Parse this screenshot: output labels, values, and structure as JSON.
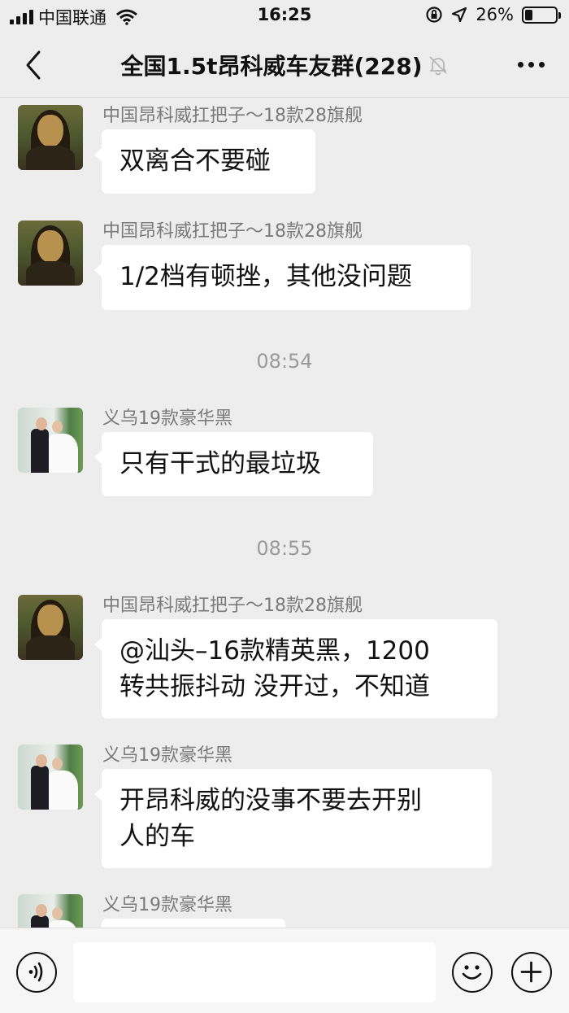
{
  "status_bar": {
    "carrier": "中国联通",
    "time": "16:25",
    "battery_percent": "26%",
    "battery_level": 0.26
  },
  "nav": {
    "title": "全国1.5t昂科威车友群(228)",
    "muted_icon": "bell-muted-icon",
    "back_icon": "chevron-left-icon",
    "more_icon": "more-dots-icon"
  },
  "messages": [
    {
      "sender": "中国昂科威扛把子～18款28旗舰",
      "avatar": "mona-lisa",
      "lines": [
        "双离合不要碰"
      ]
    },
    {
      "sender": "中国昂科威扛把子～18款28旗舰",
      "avatar": "mona-lisa",
      "lines": [
        "1/2档有顿挫，其他没问题"
      ]
    },
    {
      "time": "08:54"
    },
    {
      "sender": "义乌19款豪华黑",
      "avatar": "wedding-couple",
      "lines": [
        "只有干式的最垃圾"
      ]
    },
    {
      "time": "08:55"
    },
    {
      "sender": "中国昂科威扛把子～18款28旗舰",
      "avatar": "mona-lisa",
      "lines": [
        "@汕头–16款精英黑，1200",
        "转共振抖动 没开过，不知道"
      ]
    },
    {
      "sender": "义乌19款豪华黑",
      "avatar": "wedding-couple",
      "lines": [
        "开昂科威的没事不要去开别",
        "人的车"
      ]
    },
    {
      "sender": "义乌19款豪华黑",
      "avatar": "wedding-couple",
      "lines": [
        ""
      ]
    }
  ],
  "input_bar": {
    "voice_icon": "voice-icon",
    "emoji_icon": "emoji-icon",
    "plus_icon": "plus-icon",
    "input_value": ""
  },
  "colors": {
    "background": "#ededed",
    "bubble": "#ffffff",
    "sender_text": "#7a7a7a",
    "timestamp_text": "#9b9b9b"
  }
}
